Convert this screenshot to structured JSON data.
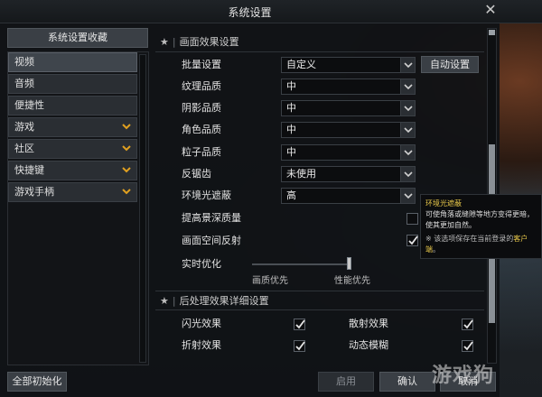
{
  "window": {
    "title": "系统设置"
  },
  "sidebar": {
    "favorites_label": "系统设置收藏",
    "items": [
      {
        "label": "视频",
        "active": true,
        "expandable": false
      },
      {
        "label": "音频",
        "active": false,
        "expandable": false
      },
      {
        "label": "便捷性",
        "active": false,
        "expandable": false
      },
      {
        "label": "游戏",
        "active": false,
        "expandable": true
      },
      {
        "label": "社区",
        "active": false,
        "expandable": true
      },
      {
        "label": "快捷键",
        "active": false,
        "expandable": true
      },
      {
        "label": "游戏手柄",
        "active": false,
        "expandable": true
      }
    ],
    "reset_label": "全部初始化"
  },
  "main": {
    "section1_title": "画面效果设置",
    "rows": [
      {
        "label": "批量设置",
        "value": "自定义"
      },
      {
        "label": "纹理品质",
        "value": "中"
      },
      {
        "label": "阴影品质",
        "value": "中"
      },
      {
        "label": "角色品质",
        "value": "中"
      },
      {
        "label": "粒子品质",
        "value": "中"
      },
      {
        "label": "反锯齿",
        "value": "未使用"
      },
      {
        "label": "环境光遮蔽",
        "value": "高"
      }
    ],
    "auto_button": "自动设置",
    "toggles": [
      {
        "label": "提高景深质量",
        "checked": false
      },
      {
        "label": "画面空间反射",
        "checked": true
      }
    ],
    "realtime": {
      "label": "实时优化",
      "left_caption": "画质优先",
      "right_caption": "性能优先",
      "level": 0.98
    },
    "section2_title": "后处理效果详细设置",
    "post_effects": [
      {
        "label": "闪光效果",
        "checked": true
      },
      {
        "label": "散射效果",
        "checked": true
      },
      {
        "label": "折射效果",
        "checked": true
      },
      {
        "label": "动态模糊",
        "checked": true
      }
    ]
  },
  "tooltip": {
    "title": "环境光遮蔽",
    "body": "可使角落或缝隙等地方变得更暗，使其更加自然。",
    "note_prefix": "※ 该选项保存在当前登录的",
    "note_accent": "客户端",
    "note_suffix": "。"
  },
  "footer": {
    "apply_label": "启用",
    "confirm_label": "确认",
    "cancel_label": "取消"
  },
  "watermark": "游戏狗",
  "colors": {
    "accent_yellow": "#e8c84a",
    "chevron": "#e0a020",
    "panel_bg": "#101215"
  }
}
